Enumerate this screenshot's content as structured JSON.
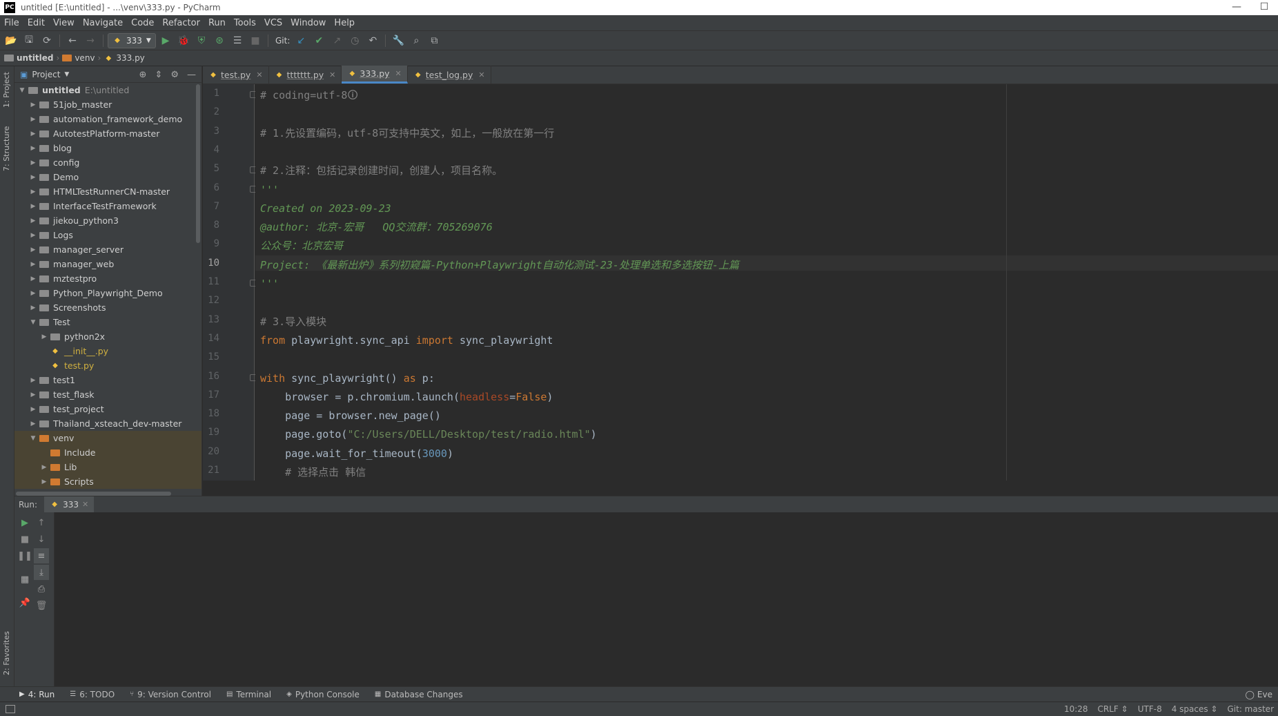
{
  "window": {
    "title": "untitled [E:\\untitled] - ...\\venv\\333.py - PyCharm",
    "logo": "PC",
    "minimize": "—",
    "maximize": "☐"
  },
  "menu": [
    "File",
    "Edit",
    "View",
    "Navigate",
    "Code",
    "Refactor",
    "Run",
    "Tools",
    "VCS",
    "Window",
    "Help"
  ],
  "toolbar": {
    "run_config": "333",
    "git_label": "Git:"
  },
  "breadcrumb": {
    "project": "untitled",
    "folder": "venv",
    "file": "333.py"
  },
  "left_strip": {
    "project": "1: Project",
    "structure": "7: Structure",
    "favorites": "2: Favorites"
  },
  "project_panel": {
    "title": "Project",
    "tree": [
      {
        "label": "untitled",
        "hint": "E:\\untitled",
        "level": 0,
        "arrow": "▼",
        "type": "folder-gray",
        "bold": true
      },
      {
        "label": "51job_master",
        "level": 1,
        "arrow": "▶",
        "type": "folder-gray"
      },
      {
        "label": "automation_framework_demo",
        "level": 1,
        "arrow": "▶",
        "type": "folder-gray"
      },
      {
        "label": "AutotestPlatform-master",
        "level": 1,
        "arrow": "▶",
        "type": "folder-gray"
      },
      {
        "label": "blog",
        "level": 1,
        "arrow": "▶",
        "type": "folder-gray"
      },
      {
        "label": "config",
        "level": 1,
        "arrow": "▶",
        "type": "folder-gray"
      },
      {
        "label": "Demo",
        "level": 1,
        "arrow": "▶",
        "type": "folder-gray"
      },
      {
        "label": "HTMLTestRunnerCN-master",
        "level": 1,
        "arrow": "▶",
        "type": "folder-gray"
      },
      {
        "label": "InterfaceTestFramework",
        "level": 1,
        "arrow": "▶",
        "type": "folder-gray"
      },
      {
        "label": "jiekou_python3",
        "level": 1,
        "arrow": "▶",
        "type": "folder-gray"
      },
      {
        "label": "Logs",
        "level": 1,
        "arrow": "▶",
        "type": "folder-gray"
      },
      {
        "label": "manager_server",
        "level": 1,
        "arrow": "▶",
        "type": "folder-gray"
      },
      {
        "label": "manager_web",
        "level": 1,
        "arrow": "▶",
        "type": "folder-gray"
      },
      {
        "label": "mztestpro",
        "level": 1,
        "arrow": "▶",
        "type": "folder-gray"
      },
      {
        "label": "Python_Playwright_Demo",
        "level": 1,
        "arrow": "▶",
        "type": "folder-gray"
      },
      {
        "label": "Screenshots",
        "level": 1,
        "arrow": "▶",
        "type": "folder-gray"
      },
      {
        "label": "Test",
        "level": 1,
        "arrow": "▼",
        "type": "folder-gray"
      },
      {
        "label": "python2x",
        "level": 2,
        "arrow": "▶",
        "type": "folder-gray"
      },
      {
        "label": "__init__.py",
        "level": 2,
        "arrow": "",
        "type": "py"
      },
      {
        "label": "test.py",
        "level": 2,
        "arrow": "",
        "type": "py"
      },
      {
        "label": "test1",
        "level": 1,
        "arrow": "▶",
        "type": "folder-gray"
      },
      {
        "label": "test_flask",
        "level": 1,
        "arrow": "▶",
        "type": "folder-gray"
      },
      {
        "label": "test_project",
        "level": 1,
        "arrow": "▶",
        "type": "folder-gray"
      },
      {
        "label": "Thailand_xsteach_dev-master",
        "level": 1,
        "arrow": "▶",
        "type": "folder-gray"
      },
      {
        "label": "venv",
        "level": 1,
        "arrow": "▼",
        "type": "folder-orange",
        "hl": true
      },
      {
        "label": "Include",
        "level": 2,
        "arrow": "",
        "type": "folder-orange",
        "hl": true
      },
      {
        "label": "Lib",
        "level": 2,
        "arrow": "▶",
        "type": "folder-orange",
        "hl": true
      },
      {
        "label": "Scripts",
        "level": 2,
        "arrow": "▶",
        "type": "folder-orange",
        "hl": true
      }
    ]
  },
  "tabs": [
    {
      "label": "test.py",
      "active": false
    },
    {
      "label": "ttttttt.py",
      "active": false
    },
    {
      "label": "333.py",
      "active": true
    },
    {
      "label": "test_log.py",
      "active": false
    }
  ],
  "editor": {
    "current_line": 10,
    "lines": [
      [
        {
          "t": "# coding=utf-8",
          "c": "c-cmt"
        },
        {
          "t": "🛈",
          "c": "c-cmt"
        }
      ],
      [],
      [
        {
          "t": "# 1.先设置编码，utf-8可支持中英文，如上，一般放在第一行",
          "c": "c-cmt"
        }
      ],
      [],
      [
        {
          "t": "# 2.注释：包括记录创建时间，创建人，项目名称。",
          "c": "c-cmt"
        }
      ],
      [
        {
          "t": "'''",
          "c": "c-doc"
        }
      ],
      [
        {
          "t": "Created on 2023-09-23",
          "c": "c-doc"
        }
      ],
      [
        {
          "t": "@author: 北京-宏哥   QQ交流群：705269076",
          "c": "c-doc"
        }
      ],
      [
        {
          "t": "公众号：北京宏哥",
          "c": "c-doc"
        }
      ],
      [
        {
          "t": "Project: 《最新出炉》系列初窥篇-Python+Playwright自动化测试-23-处理单选和多选按钮-上篇",
          "c": "c-doc"
        }
      ],
      [
        {
          "t": "'''",
          "c": "c-doc"
        }
      ],
      [],
      [
        {
          "t": "# 3.导入模块",
          "c": "c-cmt"
        }
      ],
      [
        {
          "t": "from",
          "c": "c-kw"
        },
        {
          "t": " playwright.sync_api ",
          "c": ""
        },
        {
          "t": "import",
          "c": "c-kw"
        },
        {
          "t": " sync_playwright",
          "c": ""
        }
      ],
      [],
      [
        {
          "t": "with",
          "c": "c-kw"
        },
        {
          "t": " sync_playwright() ",
          "c": ""
        },
        {
          "t": "as",
          "c": "c-kw"
        },
        {
          "t": " p:",
          "c": ""
        }
      ],
      [
        {
          "t": "    browser = p.chromium.launch(",
          "c": ""
        },
        {
          "t": "headless",
          "c": "c-param"
        },
        {
          "t": "=",
          "c": ""
        },
        {
          "t": "False",
          "c": "c-kw"
        },
        {
          "t": ")",
          "c": ""
        }
      ],
      [
        {
          "t": "    page = browser.new_page()",
          "c": ""
        }
      ],
      [
        {
          "t": "    page.goto(",
          "c": ""
        },
        {
          "t": "\"C:/Users/DELL/Desktop/test/radio.html\"",
          "c": "c-str"
        },
        {
          "t": ")",
          "c": ""
        }
      ],
      [
        {
          "t": "    page.wait_for_timeout(",
          "c": ""
        },
        {
          "t": "3000",
          "c": "c-num"
        },
        {
          "t": ")",
          "c": ""
        }
      ],
      [
        {
          "t": "    # 选择点击 韩信",
          "c": "c-cmt"
        }
      ]
    ]
  },
  "run": {
    "label": "Run:",
    "tab": "333"
  },
  "bottom_tabs": [
    {
      "num": "4",
      "label": "4: Run",
      "icon": "▶",
      "active": true
    },
    {
      "num": "6",
      "label": "6: TODO",
      "icon": "☰",
      "active": false
    },
    {
      "num": "9",
      "label": "9: Version Control",
      "icon": "⑂",
      "active": false
    },
    {
      "num": "",
      "label": "Terminal",
      "icon": "▤",
      "active": false
    },
    {
      "num": "",
      "label": "Python Console",
      "icon": "◈",
      "active": false
    },
    {
      "num": "",
      "label": "Database Changes",
      "icon": "▦",
      "active": false
    }
  ],
  "event_log": "Eve",
  "status": {
    "position": "10:28",
    "line_sep": "CRLF",
    "encoding": "UTF-8",
    "indent": "4 spaces",
    "git": "Git: master"
  }
}
